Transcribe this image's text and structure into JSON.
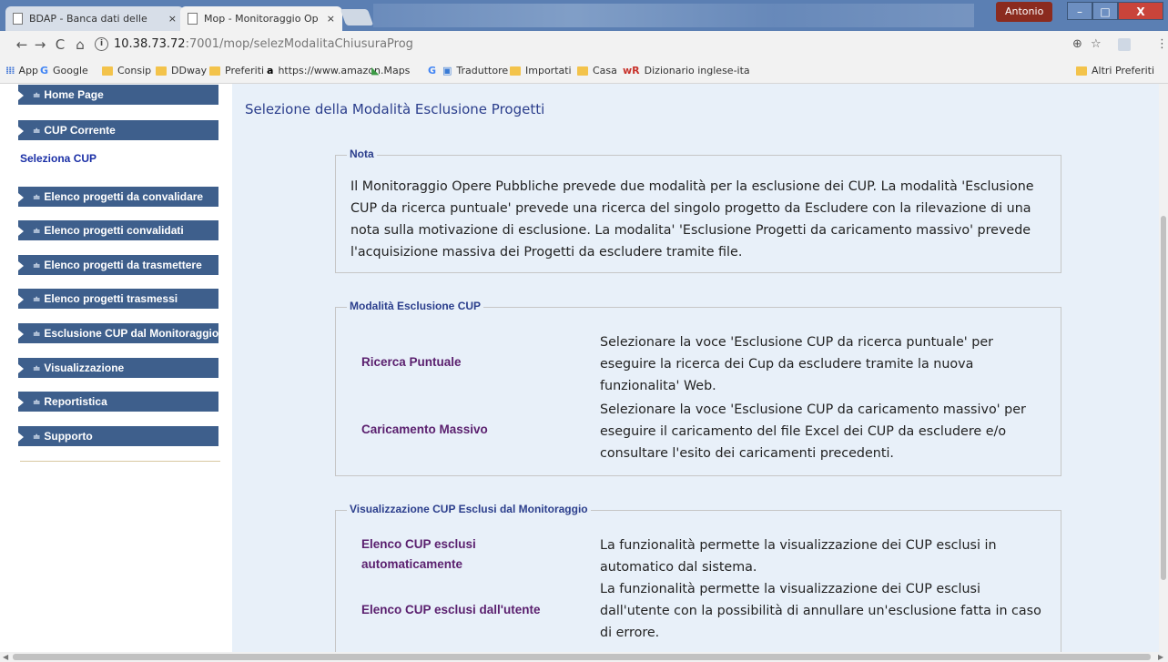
{
  "browser": {
    "tabs": [
      {
        "title": "BDAP - Banca dati delle",
        "close": "×"
      },
      {
        "title": "Mop - Monitoraggio Op",
        "close": "×"
      }
    ],
    "profile_name": "Antonio",
    "window_min": "–",
    "window_max": "□",
    "window_close": "X",
    "nav": {
      "back": "←",
      "forward": "→",
      "reload": "C",
      "home": "⌂"
    },
    "url_host": "10.38.73.72",
    "url_path": ":7001/mop/selezModalitaChiusuraProg",
    "info_glyph": "i",
    "zoom_glyph": "⊕",
    "star_glyph": "☆",
    "menu_glyph": "⋮",
    "bookmarks": [
      {
        "label": "App",
        "icon": "apps-icon"
      },
      {
        "label": "Google",
        "icon": "google-icon"
      },
      {
        "label": "Consip",
        "icon": "folder-icon"
      },
      {
        "label": "DDway",
        "icon": "folder-icon"
      },
      {
        "label": "Preferiti",
        "icon": "folder-icon"
      },
      {
        "label": "https://www.amazon.i",
        "icon": "amazon-icon"
      },
      {
        "label": "Maps",
        "icon": "maps-icon"
      },
      {
        "label": "",
        "icon": "google-icon"
      },
      {
        "label": "Traduttore",
        "icon": "translate-icon"
      },
      {
        "label": "Importati",
        "icon": "folder-icon"
      },
      {
        "label": "Casa",
        "icon": "folder-icon"
      },
      {
        "label": "Dizionario inglese-ita",
        "icon": "wordreference-icon"
      }
    ],
    "other_bookmarks": "Altri Preferiti"
  },
  "sidebar": {
    "items": [
      {
        "label": "Home Page"
      },
      {
        "label": "CUP Corrente"
      },
      {
        "label": "Elenco progetti da convalidare"
      },
      {
        "label": "Elenco progetti convalidati"
      },
      {
        "label": "Elenco progetti da trasmettere"
      },
      {
        "label": "Elenco progetti trasmessi"
      },
      {
        "label": "Esclusione CUP dal Monitoraggio"
      },
      {
        "label": "Visualizzazione"
      },
      {
        "label": "Reportistica"
      },
      {
        "label": "Supporto"
      }
    ],
    "sub_link": "Seleziona CUP",
    "bullet": "≐"
  },
  "main": {
    "title": "Selezione della Modalità Esclusione Progetti",
    "nota": {
      "legend": "Nota",
      "text": "Il Monitoraggio Opere Pubbliche prevede due modalità per la esclusione dei CUP. La modalità 'Esclusione CUP da ricerca puntuale' prevede una ricerca del singolo progetto da Escludere con la rilevazione di una nota sulla motivazione di esclusione. La modalita' 'Esclusione Progetti da caricamento massivo' prevede l'acquisizione massiva dei Progetti da escludere tramite file."
    },
    "modalita": {
      "legend": "Modalità Esclusione CUP",
      "rows": [
        {
          "label": "Ricerca Puntuale",
          "desc": "Selezionare la voce 'Esclusione CUP da ricerca puntuale' per eseguire la ricerca dei Cup da escludere tramite la nuova funzionalita' Web."
        },
        {
          "label": "Caricamento Massivo",
          "desc": "Selezionare la voce 'Esclusione CUP da caricamento massivo' per eseguire il caricamento del file Excel dei CUP da escludere e/o consultare l'esito dei caricamenti precedenti."
        }
      ]
    },
    "visualizzazione": {
      "legend": "Visualizzazione CUP Esclusi dal Monitoraggio",
      "rows": [
        {
          "label": "Elenco CUP esclusi automaticamente",
          "desc": "La funzionalità permette la visualizzazione dei CUP esclusi in automatico dal sistema."
        },
        {
          "label": "Elenco CUP esclusi dall'utente",
          "desc": "La funzionalità permette la visualizzazione dei CUP esclusi dall'utente con la possibilità di annullare un'esclusione fatta in caso di errore."
        }
      ]
    }
  }
}
